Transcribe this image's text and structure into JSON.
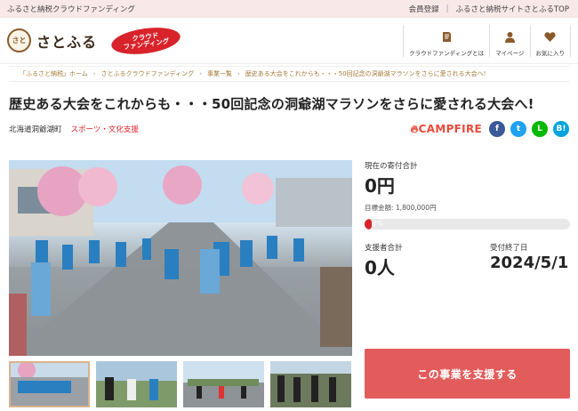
{
  "topbar": {
    "site_label": "ふるさと納税クラウドファンディング",
    "register": "会員登録",
    "top_link": "ふるさと納税サイトさとふるTOP"
  },
  "header": {
    "logo_text": "さとふる",
    "logo_mark": "さと",
    "cf_badge_line1": "クラウド",
    "cf_badge_line2": "ファンディング",
    "nav": [
      {
        "label": "クラウドファンディングとは",
        "icon": "book-icon"
      },
      {
        "label": "マイページ",
        "icon": "person-icon"
      },
      {
        "label": "お気に入り",
        "icon": "heart-icon"
      }
    ]
  },
  "breadcrumb": [
    "「ふるさと納税」ホーム",
    "さとふるクラウドファンディング",
    "事業一覧",
    "歴史ある大会をこれからも・・・50回記念の洞爺湖マラソンをさらに愛される大会へ!"
  ],
  "project": {
    "title": "歴史ある大会をこれからも・・・50回記念の洞爺湖マラソンをさらに愛される大会へ!",
    "municipality": "北海道洞爺湖町",
    "category": "スポーツ・文化支援",
    "platform": "CAMPFIRE"
  },
  "share": [
    {
      "name": "facebook",
      "glyph": "f",
      "color": "#3b5998"
    },
    {
      "name": "twitter",
      "glyph": "t",
      "color": "#1da1f2"
    },
    {
      "name": "line",
      "glyph": "L",
      "color": "#00b900"
    },
    {
      "name": "hatena",
      "glyph": "B!",
      "color": "#00a4de"
    }
  ],
  "funding": {
    "current_label": "現在の寄付合計",
    "current_value": "0円",
    "goal_text": "目標金額: 1,800,000円",
    "progress_text": "0%",
    "progress_percent": 0,
    "supporters_label": "支援者合計",
    "supporters_value": "0人",
    "end_label": "受付終了日",
    "end_value": "2024/5/1",
    "support_button": "この事業を支援する"
  },
  "colors": {
    "accent": "#d8232a",
    "button": "#e25c5c",
    "topbar_bg": "#f9e8e8"
  }
}
